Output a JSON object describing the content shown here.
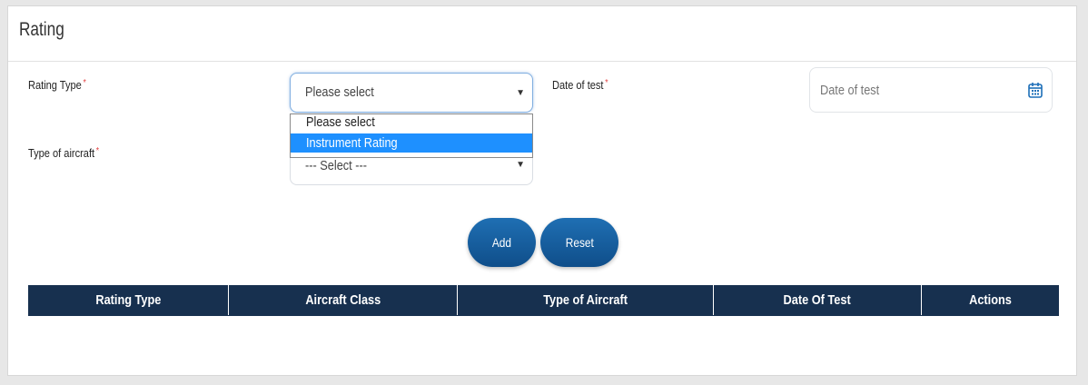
{
  "card": {
    "title": "Rating"
  },
  "form": {
    "rating_type": {
      "label": "Rating Type",
      "required_mark": "*",
      "value": "Please select",
      "options": [
        "Please select",
        "Instrument Rating"
      ],
      "highlighted_option": "Instrument Rating",
      "caret": "▼"
    },
    "date_of_test": {
      "label": "Date of test",
      "required_mark": "*",
      "placeholder": "Date of test"
    },
    "type_of_aircraft": {
      "label": "Type of aircraft",
      "required_mark": "*",
      "value": "--- Select ---",
      "caret": "▼"
    }
  },
  "buttons": {
    "add": "Add",
    "reset": "Reset"
  },
  "table": {
    "columns": [
      "Rating Type",
      "Aircraft Class",
      "Type of Aircraft",
      "Date Of Test",
      "Actions"
    ],
    "rows": []
  },
  "colors": {
    "header_bg": "#17304f",
    "button": "#1565a8",
    "highlight": "#1e90ff",
    "required": "#e23b3b"
  },
  "icons": {
    "date_picker": "calendar-icon"
  }
}
